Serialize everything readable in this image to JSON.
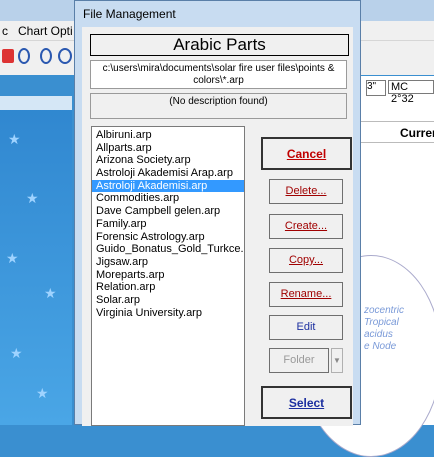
{
  "background": {
    "menu_items": [
      "c",
      "Chart Opti"
    ],
    "field_a": "3\"",
    "field_b": "MC 2°32",
    "current_label": "Curren",
    "wheel_text": [
      "zocentric",
      "Tropical",
      "acidus",
      "e Node"
    ]
  },
  "dialog": {
    "title": "File Management",
    "set_title": "Arabic Parts",
    "path": "c:\\users\\mira\\documents\\solar fire user files\\points & colors\\*.arp",
    "description": "(No description found)",
    "files": [
      "Albiruni.arp",
      "Allparts.arp",
      "Arizona Society.arp",
      "Astroloji Akademisi Arap.arp",
      "Astroloji Akademisi.arp",
      "Commodities.arp",
      "Dave Campbell gelen.arp",
      "Family.arp",
      "Forensic Astrology.arp",
      "Guido_Bonatus_Gold_Turkce.a",
      "Jigsaw.arp",
      "Moreparts.arp",
      "Relation.arp",
      "Solar.arp",
      "Virginia University.arp"
    ],
    "selected_index": 4,
    "buttons": {
      "cancel": "Cancel",
      "delete": "Delete...",
      "create": "Create...",
      "copy": "Copy...",
      "rename": "Rename...",
      "edit": "Edit",
      "folder": "Folder",
      "select": "Select"
    }
  }
}
